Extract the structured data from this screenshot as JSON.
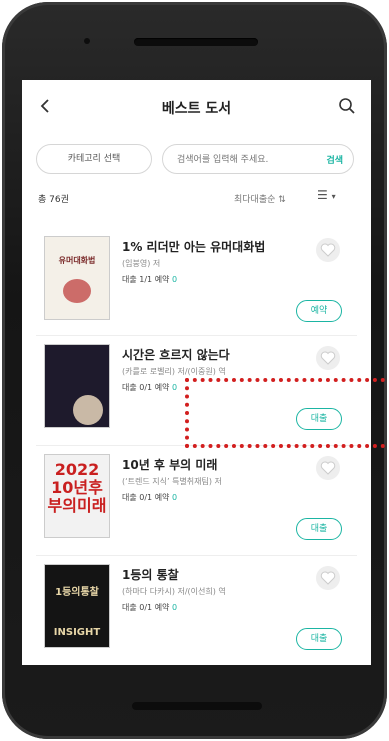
{
  "header": {
    "title": "베스트 도서"
  },
  "filters": {
    "category_label": "카테고리 선택",
    "search_placeholder": "검색어를 입력해 주세요.",
    "search_button": "검색"
  },
  "list_meta": {
    "count": "총 76권",
    "sort_label": "최다대출순 ⇅"
  },
  "books": [
    {
      "title": "1% 리더만 아는 유머대화법",
      "author": "(임붕영) 저",
      "stat_prefix": "대출 1/1",
      "reserve_label": "예약",
      "reserve_count": "0",
      "action": "예약",
      "cover_text": "유머대화법"
    },
    {
      "title": "시간은 흐르지 않는다",
      "author": "(카를로 로벨리) 저/(이중원) 역",
      "stat_prefix": "대출 0/1",
      "reserve_label": "예약",
      "reserve_count": "0",
      "action": "대출",
      "cover_text": ""
    },
    {
      "title": "10년 후 부의 미래",
      "author": "(‘트렌드 지식’ 특별취재팀) 저",
      "stat_prefix": "대출 0/1",
      "reserve_label": "예약",
      "reserve_count": "0",
      "action": "대출",
      "cover_text": "2022 10년후 부의미래"
    },
    {
      "title": "1등의 통찰",
      "author": "(하마다 다카시) 저/(이선희) 역",
      "stat_prefix": "대출 0/1",
      "reserve_label": "예약",
      "reserve_count": "0",
      "action": "대출",
      "cover_text": "1등의통찰 INSIGHT"
    }
  ],
  "colors": {
    "accent": "#1bb5a3",
    "highlight": "#d21f1f"
  }
}
